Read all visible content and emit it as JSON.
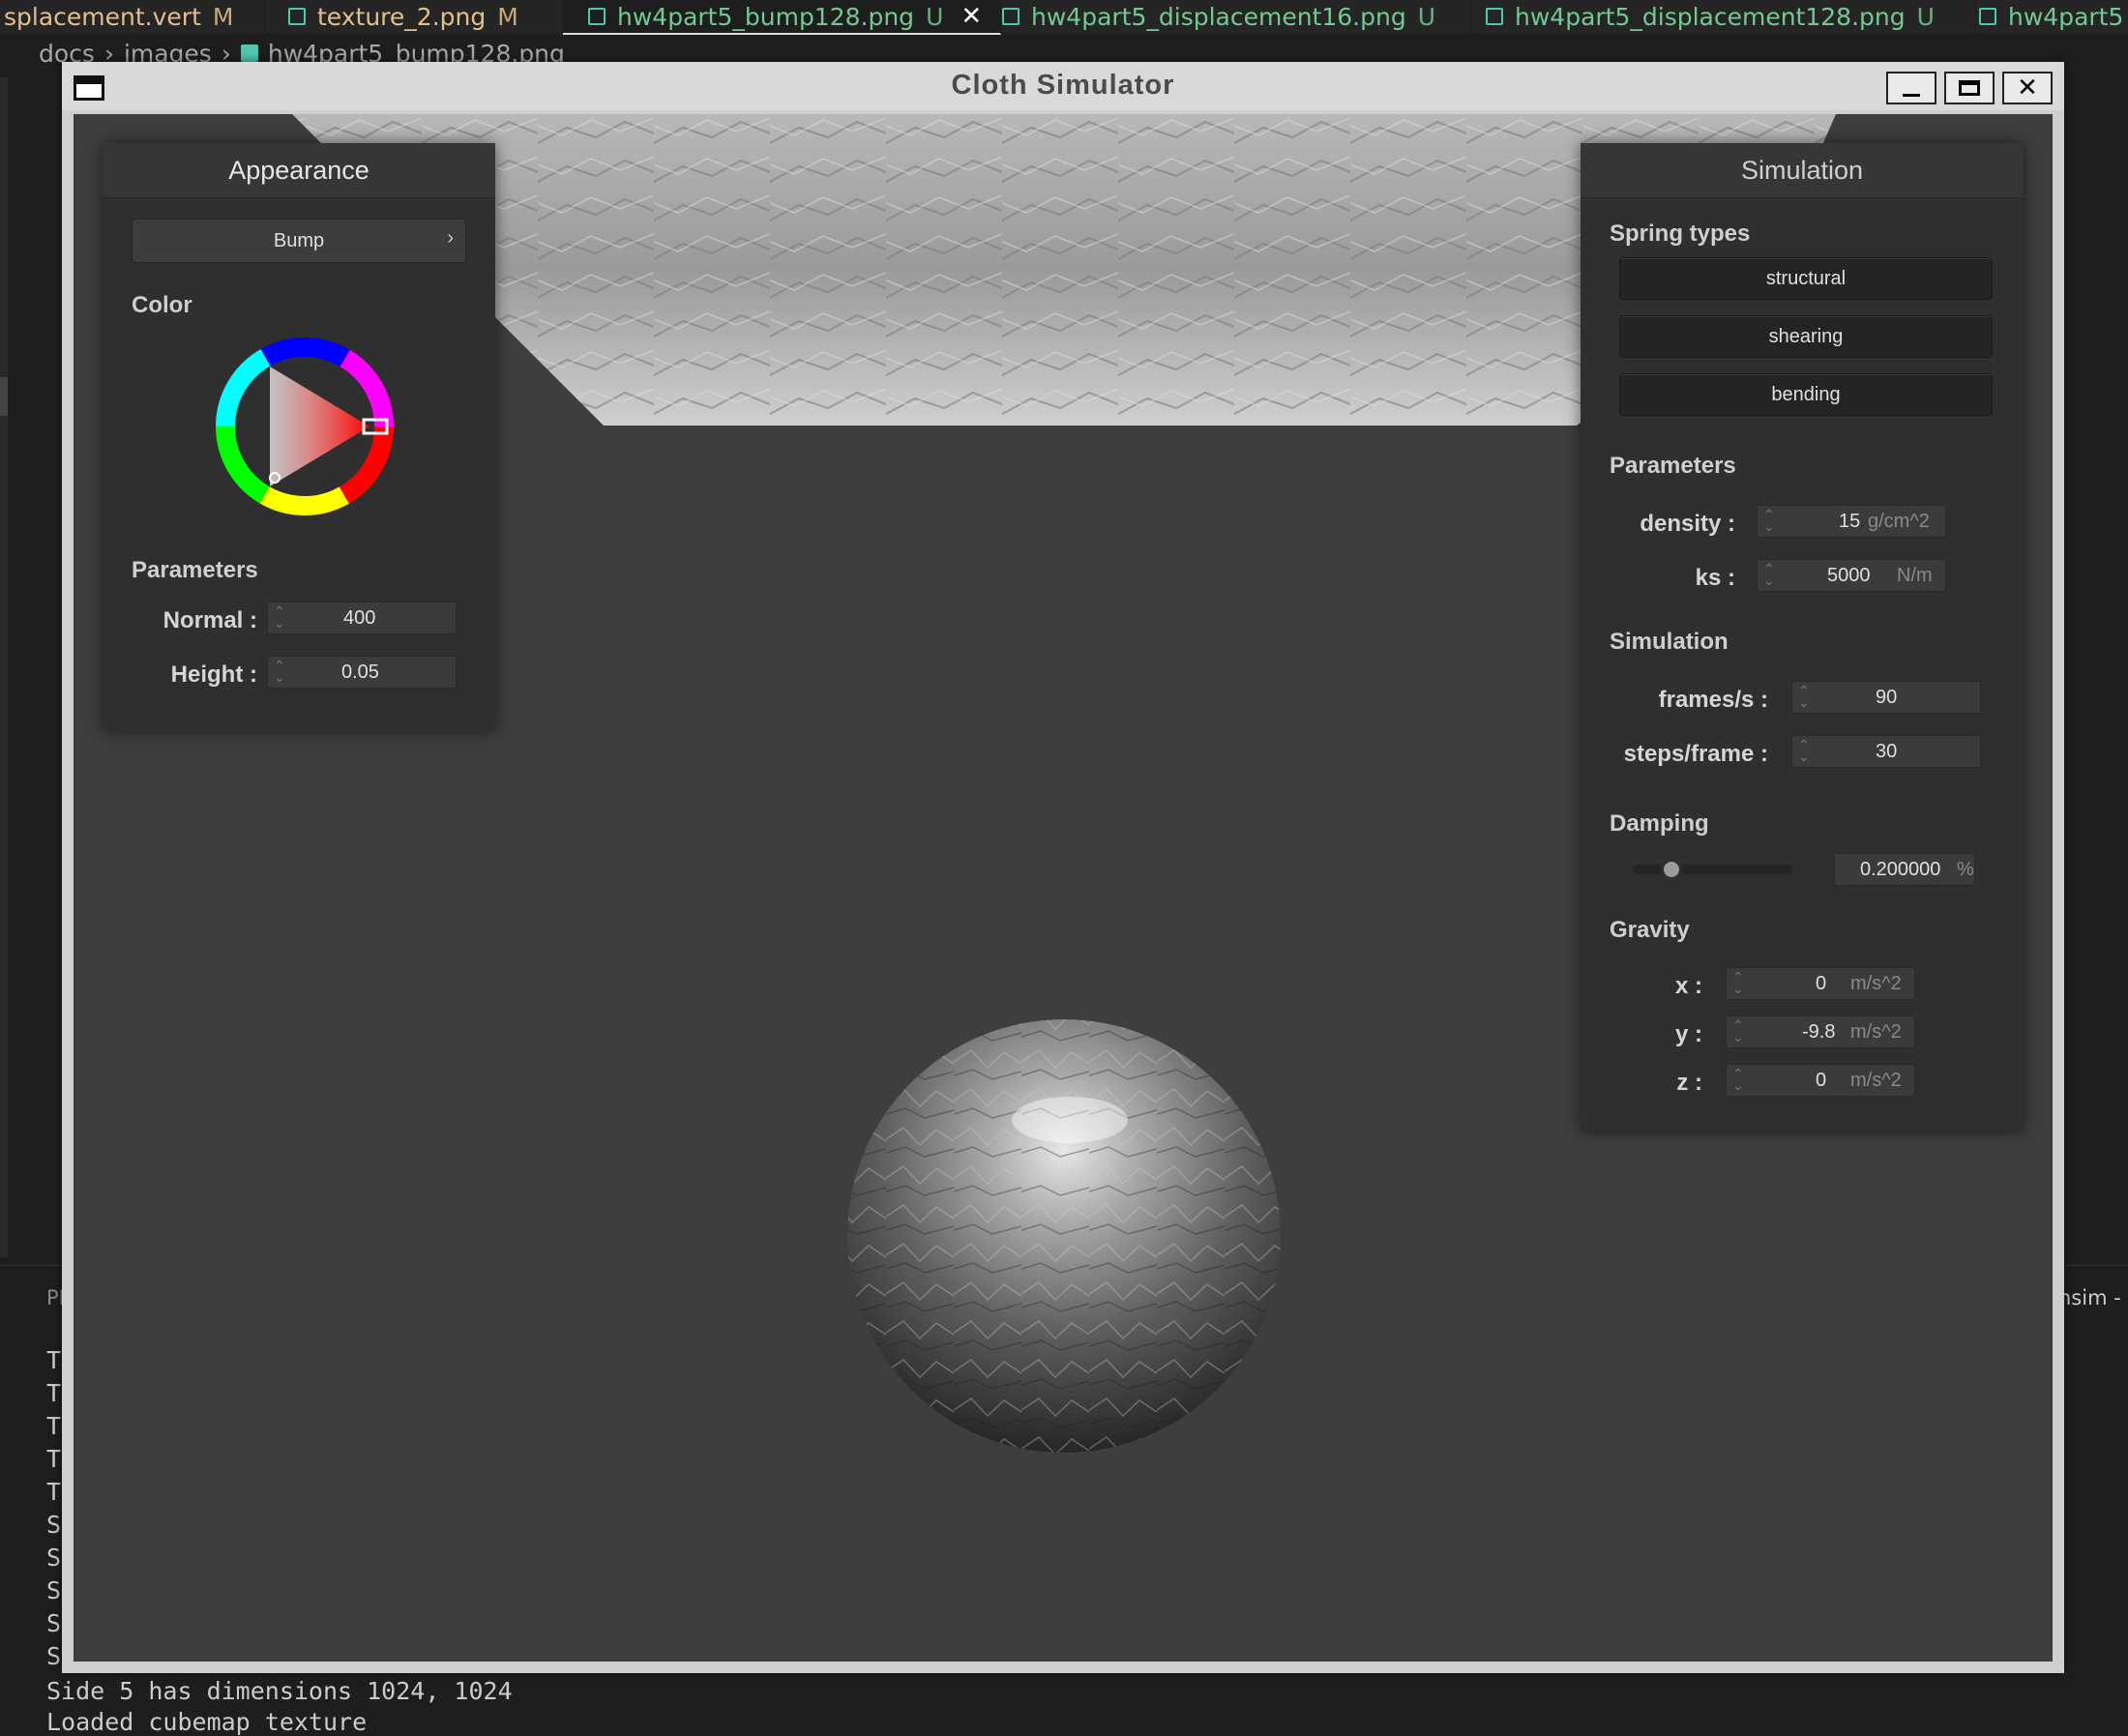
{
  "editor": {
    "tabs": [
      {
        "label": "splacement.vert",
        "badge": "M"
      },
      {
        "label": "texture_2.png",
        "badge": "M"
      },
      {
        "label": "hw4part5_bump128.png",
        "badge": "U"
      },
      {
        "label": "hw4part5_displacement16.png",
        "badge": "U"
      },
      {
        "label": "hw4part5_displacement128.png",
        "badge": "U"
      },
      {
        "label": "hw4part5",
        "badge": ""
      }
    ],
    "breadcrumb": [
      "docs",
      "images",
      "hw4part5_bump128.png"
    ]
  },
  "terminal": {
    "title": "PI",
    "right_label": "nsim -",
    "visible_line_prefixes": [
      "T",
      "T",
      "T",
      "T",
      "T",
      "S",
      "S",
      "S",
      "S",
      "S"
    ],
    "lines": [
      "Side 5 has dimensions 1024, 1024",
      "Loaded cubemap texture"
    ]
  },
  "window": {
    "title": "Cloth Simulator"
  },
  "appearance": {
    "title": "Appearance",
    "shader": "Bump",
    "color_label": "Color",
    "color_hue": "#ff0000",
    "params_label": "Parameters",
    "normal_label": "Normal :",
    "normal_value": "400",
    "height_label": "Height :",
    "height_value": "0.05"
  },
  "simulation": {
    "title": "Simulation",
    "spring_types_label": "Spring types",
    "spring_types": [
      "structural",
      "shearing",
      "bending"
    ],
    "params_label": "Parameters",
    "density_label": "density :",
    "density_value": "15",
    "density_unit": "g/cm^2",
    "ks_label": "ks :",
    "ks_value": "5000",
    "ks_unit": "N/m",
    "sim_label": "Simulation",
    "fps_label": "frames/s :",
    "fps_value": "90",
    "steps_label": "steps/frame :",
    "steps_value": "30",
    "damping_label": "Damping",
    "damping_value": "0.200000",
    "damping_unit": "%",
    "damping_slider_fraction": 0.2,
    "gravity_label": "Gravity",
    "gx_label": "x :",
    "gx_value": "0",
    "gy_label": "y :",
    "gy_value": "-9.8",
    "gz_label": "z :",
    "gz_value": "0",
    "gravity_unit": "m/s^2"
  }
}
